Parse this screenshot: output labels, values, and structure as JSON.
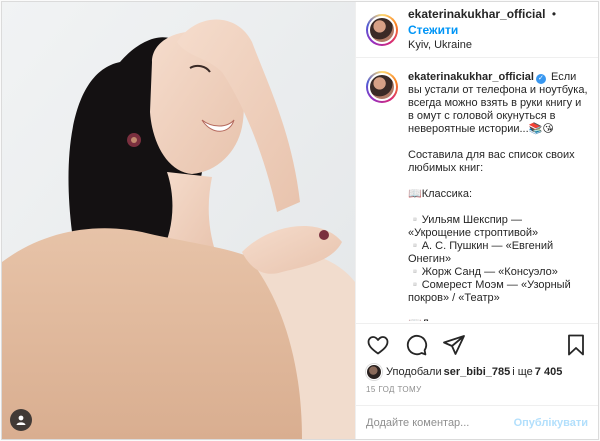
{
  "post": {
    "author": {
      "username": "ekaterinakukhar_official",
      "location": "Kyiv, Ukraine",
      "follow_label": "Стежити",
      "separator": "•",
      "verified_glyph": "✓"
    },
    "caption": {
      "username": "ekaterinakukhar_official",
      "text": " Если вы устали от телефона и ноутбука, всегда можно взять в руки книгу и в омут с головой окунуться в невероятные истории...📚😘\n\nСоставила для вас список своих любимых книг:\n\n📖Классика:\n\n▫️Уильям Шекспир — «Укрощение строптивой»\n▫️А. С. Пушкин — «Евгений Онегин»\n▫️Жорж Санд — «Консуэло»\n▫️Сомерест Моэм — «Узорный покров» / «Театр»\n\n📖Детективы:"
    },
    "actions": {
      "like_icon": "heart-icon",
      "comment_icon": "comment-icon",
      "share_icon": "share-icon",
      "save_icon": "bookmark-icon"
    },
    "likes": {
      "prefix": "Уподобали",
      "user": "ser_bibi_785",
      "middle": "і ще",
      "count": "7 405"
    },
    "timestamp": "15 ГОД ТОМУ",
    "comment": {
      "placeholder": "Додайте коментар...",
      "publish_label": "Опублікувати"
    }
  },
  "colors": {
    "accent": "#0095f6",
    "publish_disabled": "#b2dffc",
    "muted": "#8e8e8e",
    "text": "#262626",
    "verified": "#3897f0"
  }
}
